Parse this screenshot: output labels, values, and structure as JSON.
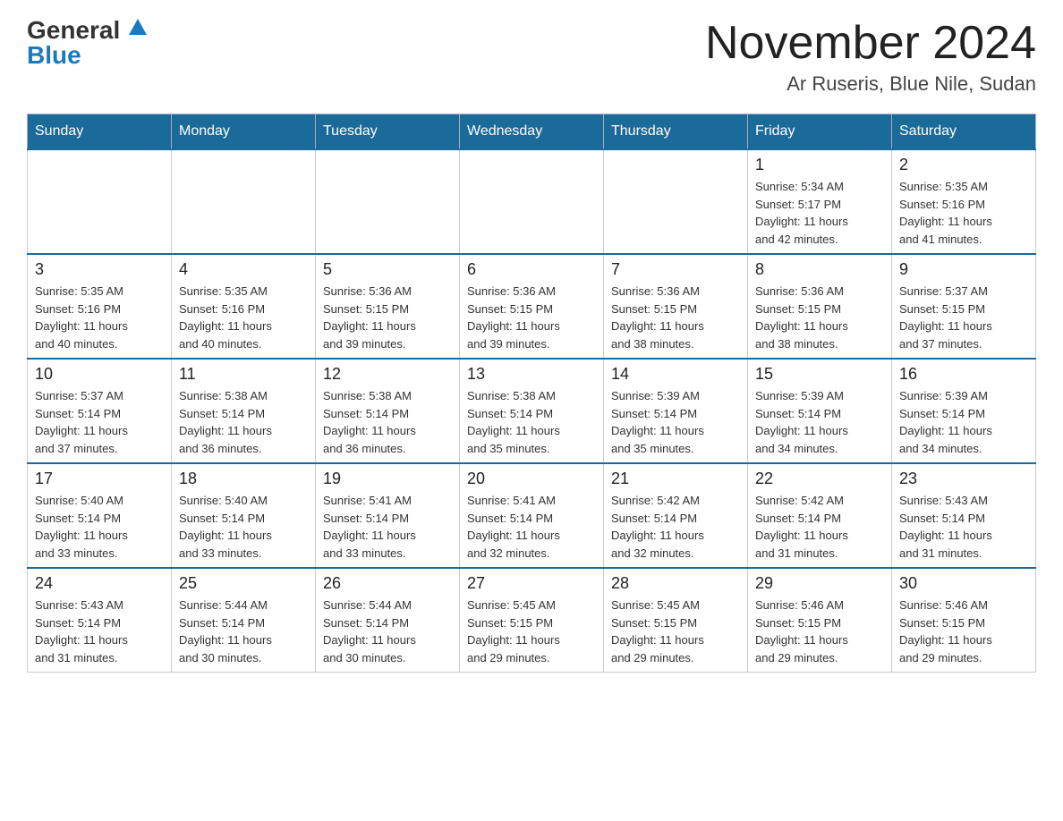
{
  "logo": {
    "general": "General",
    "blue": "Blue"
  },
  "title": "November 2024",
  "location": "Ar Ruseris, Blue Nile, Sudan",
  "headers": [
    "Sunday",
    "Monday",
    "Tuesday",
    "Wednesday",
    "Thursday",
    "Friday",
    "Saturday"
  ],
  "weeks": [
    [
      {
        "day": "",
        "info": ""
      },
      {
        "day": "",
        "info": ""
      },
      {
        "day": "",
        "info": ""
      },
      {
        "day": "",
        "info": ""
      },
      {
        "day": "",
        "info": ""
      },
      {
        "day": "1",
        "info": "Sunrise: 5:34 AM\nSunset: 5:17 PM\nDaylight: 11 hours\nand 42 minutes."
      },
      {
        "day": "2",
        "info": "Sunrise: 5:35 AM\nSunset: 5:16 PM\nDaylight: 11 hours\nand 41 minutes."
      }
    ],
    [
      {
        "day": "3",
        "info": "Sunrise: 5:35 AM\nSunset: 5:16 PM\nDaylight: 11 hours\nand 40 minutes."
      },
      {
        "day": "4",
        "info": "Sunrise: 5:35 AM\nSunset: 5:16 PM\nDaylight: 11 hours\nand 40 minutes."
      },
      {
        "day": "5",
        "info": "Sunrise: 5:36 AM\nSunset: 5:15 PM\nDaylight: 11 hours\nand 39 minutes."
      },
      {
        "day": "6",
        "info": "Sunrise: 5:36 AM\nSunset: 5:15 PM\nDaylight: 11 hours\nand 39 minutes."
      },
      {
        "day": "7",
        "info": "Sunrise: 5:36 AM\nSunset: 5:15 PM\nDaylight: 11 hours\nand 38 minutes."
      },
      {
        "day": "8",
        "info": "Sunrise: 5:36 AM\nSunset: 5:15 PM\nDaylight: 11 hours\nand 38 minutes."
      },
      {
        "day": "9",
        "info": "Sunrise: 5:37 AM\nSunset: 5:15 PM\nDaylight: 11 hours\nand 37 minutes."
      }
    ],
    [
      {
        "day": "10",
        "info": "Sunrise: 5:37 AM\nSunset: 5:14 PM\nDaylight: 11 hours\nand 37 minutes."
      },
      {
        "day": "11",
        "info": "Sunrise: 5:38 AM\nSunset: 5:14 PM\nDaylight: 11 hours\nand 36 minutes."
      },
      {
        "day": "12",
        "info": "Sunrise: 5:38 AM\nSunset: 5:14 PM\nDaylight: 11 hours\nand 36 minutes."
      },
      {
        "day": "13",
        "info": "Sunrise: 5:38 AM\nSunset: 5:14 PM\nDaylight: 11 hours\nand 35 minutes."
      },
      {
        "day": "14",
        "info": "Sunrise: 5:39 AM\nSunset: 5:14 PM\nDaylight: 11 hours\nand 35 minutes."
      },
      {
        "day": "15",
        "info": "Sunrise: 5:39 AM\nSunset: 5:14 PM\nDaylight: 11 hours\nand 34 minutes."
      },
      {
        "day": "16",
        "info": "Sunrise: 5:39 AM\nSunset: 5:14 PM\nDaylight: 11 hours\nand 34 minutes."
      }
    ],
    [
      {
        "day": "17",
        "info": "Sunrise: 5:40 AM\nSunset: 5:14 PM\nDaylight: 11 hours\nand 33 minutes."
      },
      {
        "day": "18",
        "info": "Sunrise: 5:40 AM\nSunset: 5:14 PM\nDaylight: 11 hours\nand 33 minutes."
      },
      {
        "day": "19",
        "info": "Sunrise: 5:41 AM\nSunset: 5:14 PM\nDaylight: 11 hours\nand 33 minutes."
      },
      {
        "day": "20",
        "info": "Sunrise: 5:41 AM\nSunset: 5:14 PM\nDaylight: 11 hours\nand 32 minutes."
      },
      {
        "day": "21",
        "info": "Sunrise: 5:42 AM\nSunset: 5:14 PM\nDaylight: 11 hours\nand 32 minutes."
      },
      {
        "day": "22",
        "info": "Sunrise: 5:42 AM\nSunset: 5:14 PM\nDaylight: 11 hours\nand 31 minutes."
      },
      {
        "day": "23",
        "info": "Sunrise: 5:43 AM\nSunset: 5:14 PM\nDaylight: 11 hours\nand 31 minutes."
      }
    ],
    [
      {
        "day": "24",
        "info": "Sunrise: 5:43 AM\nSunset: 5:14 PM\nDaylight: 11 hours\nand 31 minutes."
      },
      {
        "day": "25",
        "info": "Sunrise: 5:44 AM\nSunset: 5:14 PM\nDaylight: 11 hours\nand 30 minutes."
      },
      {
        "day": "26",
        "info": "Sunrise: 5:44 AM\nSunset: 5:14 PM\nDaylight: 11 hours\nand 30 minutes."
      },
      {
        "day": "27",
        "info": "Sunrise: 5:45 AM\nSunset: 5:15 PM\nDaylight: 11 hours\nand 29 minutes."
      },
      {
        "day": "28",
        "info": "Sunrise: 5:45 AM\nSunset: 5:15 PM\nDaylight: 11 hours\nand 29 minutes."
      },
      {
        "day": "29",
        "info": "Sunrise: 5:46 AM\nSunset: 5:15 PM\nDaylight: 11 hours\nand 29 minutes."
      },
      {
        "day": "30",
        "info": "Sunrise: 5:46 AM\nSunset: 5:15 PM\nDaylight: 11 hours\nand 29 minutes."
      }
    ]
  ]
}
